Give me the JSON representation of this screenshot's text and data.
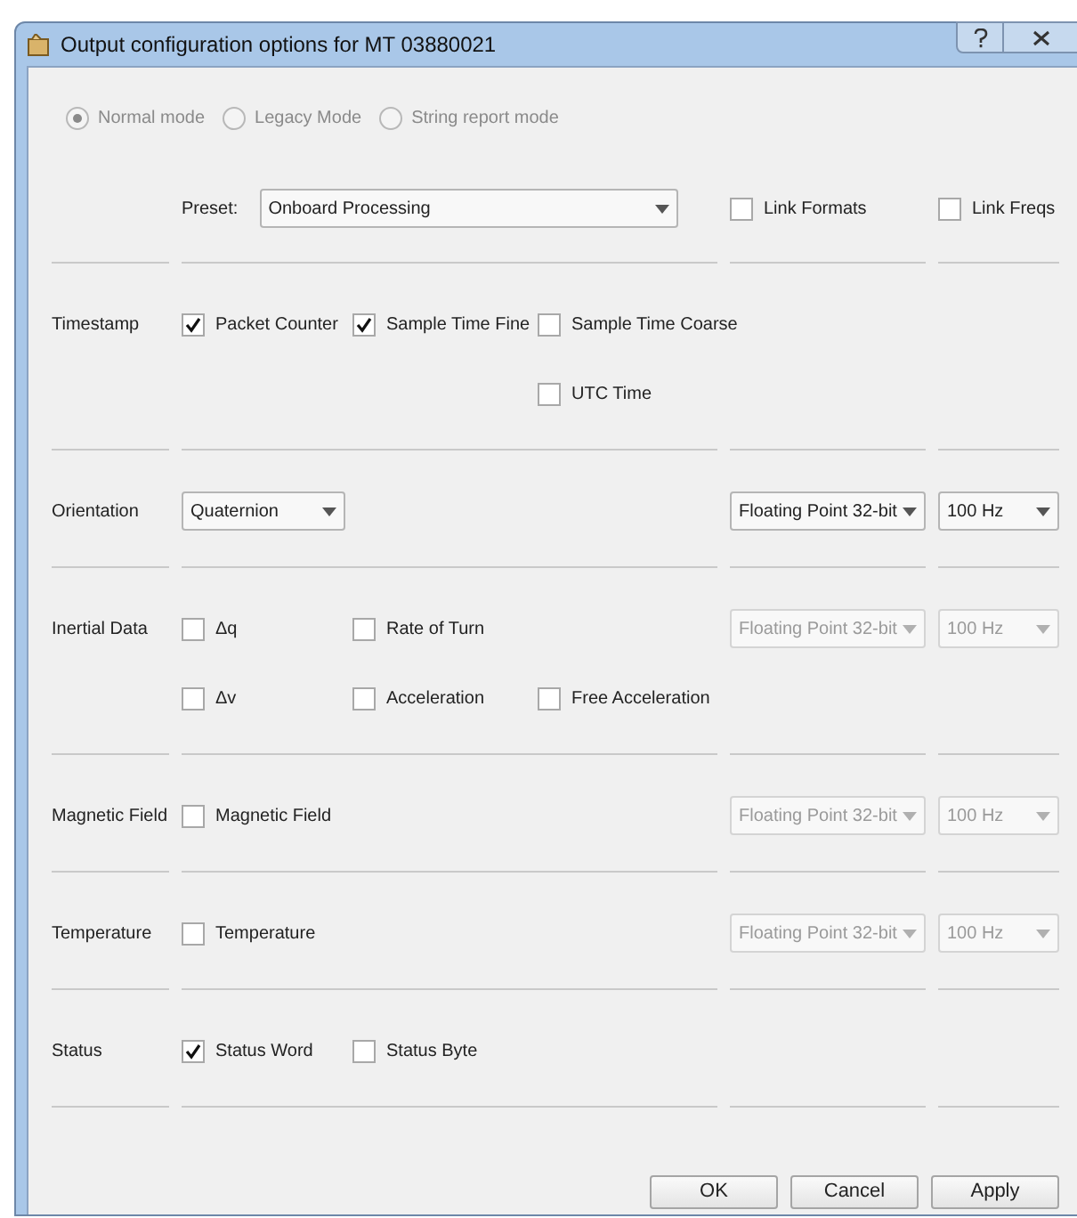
{
  "window": {
    "title": "Output configuration options for MT 03880021"
  },
  "modes": [
    {
      "label": "Normal mode",
      "selected": true,
      "disabled": true
    },
    {
      "label": "Legacy Mode",
      "selected": false,
      "disabled": true
    },
    {
      "label": "String report mode",
      "selected": false,
      "disabled": true
    }
  ],
  "preset": {
    "label": "Preset:",
    "value": "Onboard Processing"
  },
  "link_options": [
    {
      "label": "Link Formats",
      "checked": false
    },
    {
      "label": "Link Freqs",
      "checked": false
    }
  ],
  "groups": [
    {
      "label": "Timestamp",
      "kind": "checkboxes",
      "rows": [
        [
          {
            "label": "Packet Counter",
            "checked": true
          },
          {
            "label": "Sample Time Fine",
            "checked": true
          },
          {
            "label": "Sample Time Coarse",
            "checked": false
          }
        ],
        [
          null,
          null,
          {
            "label": "UTC Time",
            "checked": false
          }
        ]
      ]
    },
    {
      "label": "Orientation",
      "kind": "dropdown",
      "value": "Quaternion",
      "format": {
        "value": "Floating Point 32-bit",
        "disabled": false
      },
      "frequency": {
        "value": "100 Hz",
        "disabled": false
      }
    },
    {
      "label": "Inertial Data",
      "kind": "checkboxes",
      "rows": [
        [
          {
            "label": "Δq",
            "checked": false
          },
          {
            "label": "Rate of Turn",
            "checked": false
          }
        ],
        [
          {
            "label": "Δv",
            "checked": false
          },
          {
            "label": "Acceleration",
            "checked": false
          },
          {
            "label": "Free Acceleration",
            "checked": false
          }
        ]
      ],
      "format": {
        "value": "Floating Point 32-bit",
        "disabled": true
      },
      "frequency": {
        "value": "100 Hz",
        "disabled": true
      }
    },
    {
      "label": "Magnetic Field",
      "kind": "checkboxes",
      "rows": [
        [
          {
            "label": "Magnetic Field",
            "checked": false
          }
        ]
      ],
      "format": {
        "value": "Floating Point 32-bit",
        "disabled": true
      },
      "frequency": {
        "value": "100 Hz",
        "disabled": true
      }
    },
    {
      "label": "Temperature",
      "kind": "checkboxes",
      "rows": [
        [
          {
            "label": "Temperature",
            "checked": false
          }
        ]
      ],
      "format": {
        "value": "Floating Point 32-bit",
        "disabled": true
      },
      "frequency": {
        "value": "100 Hz",
        "disabled": true
      }
    },
    {
      "label": "Status",
      "kind": "checkboxes",
      "rows": [
        [
          {
            "label": "Status Word",
            "checked": true
          },
          {
            "label": "Status Byte",
            "checked": false
          }
        ]
      ]
    }
  ],
  "buttons": [
    "OK",
    "Cancel",
    "Apply"
  ]
}
